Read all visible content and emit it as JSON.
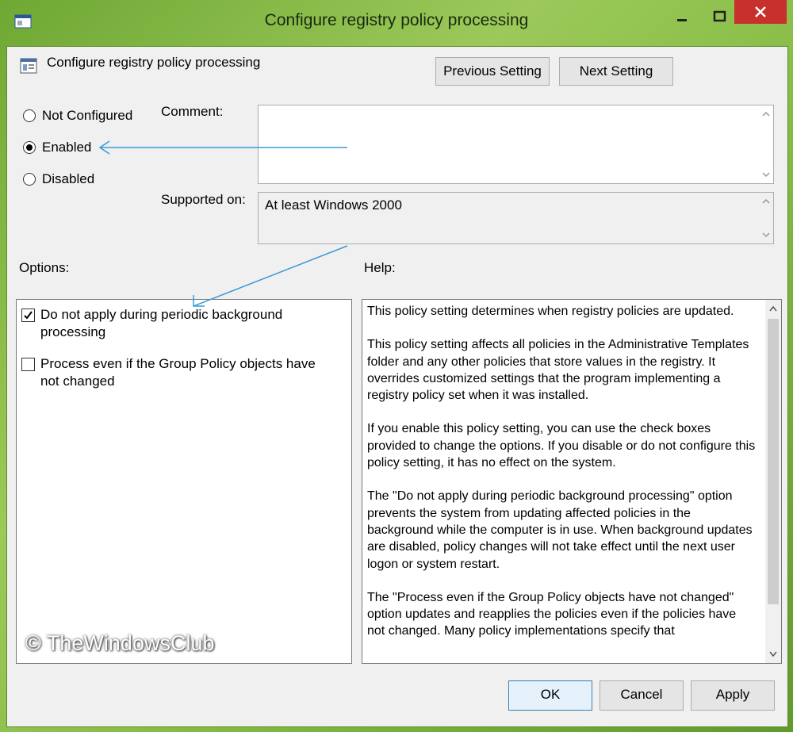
{
  "window": {
    "title": "Configure registry policy processing",
    "colors": {
      "close_button": "#c7302b",
      "annotation_arrow": "#3a9ad9"
    }
  },
  "header": {
    "title": "Configure registry policy processing",
    "prev_label": "Previous Setting",
    "next_label": "Next Setting"
  },
  "state": {
    "options": [
      {
        "label": "Not Configured",
        "selected": false
      },
      {
        "label": "Enabled",
        "selected": true
      },
      {
        "label": "Disabled",
        "selected": false
      }
    ]
  },
  "comment": {
    "label": "Comment:",
    "value": ""
  },
  "supported": {
    "label": "Supported on:",
    "value": "At least Windows 2000"
  },
  "options_section": {
    "label": "Options:",
    "items": [
      {
        "label": "Do not apply during periodic background processing",
        "checked": true
      },
      {
        "label": "Process even if the Group Policy objects have not changed",
        "checked": false
      }
    ]
  },
  "help_section": {
    "label": "Help:",
    "paragraphs": [
      "This policy setting determines when registry policies are updated.",
      "This policy setting affects all policies in the Administrative Templates folder and any other policies that store values in the registry. It overrides customized settings that the program implementing a registry policy set when it was installed.",
      "If you enable this policy setting, you can use the check boxes provided to change the options. If you disable or do not configure this policy setting, it has no effect on the system.",
      "The \"Do not apply during periodic background processing\" option prevents the system from updating affected policies in the background while the computer is in use. When background updates are disabled, policy changes will not take effect until the next user logon or system restart.",
      "The \"Process even if the Group Policy objects have not changed\" option updates and reapplies the policies even if the policies have not changed. Many policy implementations specify that"
    ]
  },
  "footer": {
    "watermark": "© TheWindowsClub",
    "ok_label": "OK",
    "cancel_label": "Cancel",
    "apply_label": "Apply"
  }
}
